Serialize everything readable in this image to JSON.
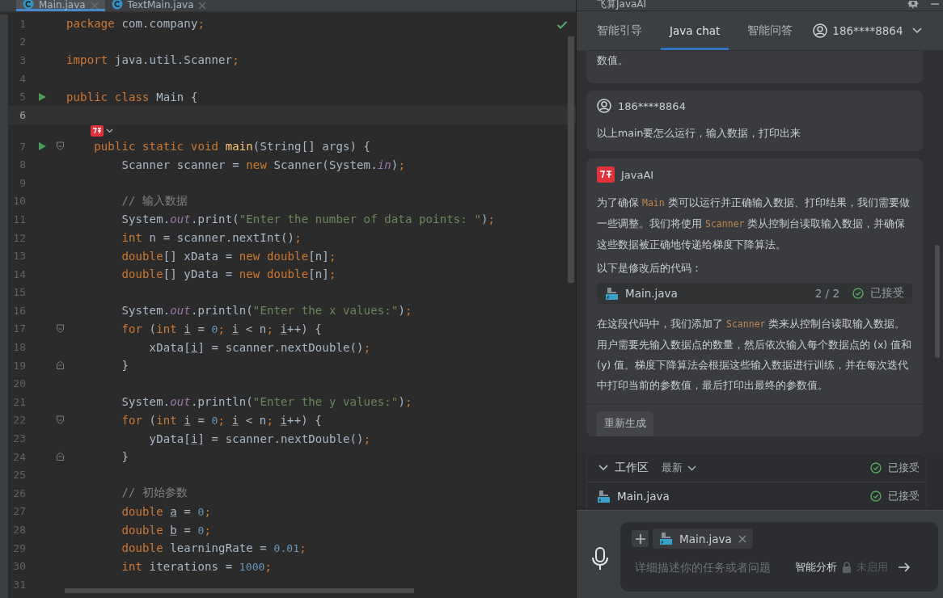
{
  "editor": {
    "tabs": [
      {
        "label": "Main.java",
        "selected": true
      },
      {
        "label": "TextMain.java",
        "selected": false
      }
    ],
    "lines": [
      {
        "number": "1",
        "tokens": [
          {
            "kind": "kw",
            "text": "package"
          },
          {
            "kind": "plain",
            "text": " com.company"
          },
          {
            "kind": "kw",
            "text": ";"
          }
        ]
      },
      {
        "number": "2"
      },
      {
        "number": "3",
        "tokens": [
          {
            "kind": "kw",
            "text": "import"
          },
          {
            "kind": "plain",
            "text": " java.util.Scanner"
          },
          {
            "kind": "kw",
            "text": ";"
          }
        ]
      },
      {
        "number": "4"
      },
      {
        "number": "5",
        "kind": "run",
        "tokens": [
          {
            "kind": "kw",
            "text": "public class"
          },
          {
            "kind": "plain",
            "text": " Main {"
          }
        ]
      },
      {
        "number": "6",
        "current": true
      },
      {
        "number": "7",
        "kind": "run-fold",
        "ai_hint": true,
        "tokens": [
          {
            "kind": "kw",
            "text": "    public static void "
          },
          {
            "kind": "method",
            "text": "main"
          },
          {
            "kind": "plain",
            "text": "(String[] args) {"
          }
        ]
      },
      {
        "number": "8",
        "tokens": [
          {
            "kind": "plain",
            "text": "        Scanner scanner = "
          },
          {
            "kind": "kw",
            "text": "new"
          },
          {
            "kind": "plain",
            "text": " Scanner(System."
          },
          {
            "kind": "field",
            "text": "in"
          },
          {
            "kind": "plain",
            "text": ")"
          },
          {
            "kind": "kw",
            "text": ";"
          }
        ]
      },
      {
        "number": "9"
      },
      {
        "number": "10",
        "tokens": [
          {
            "kind": "comment",
            "text": "        // 输入数据"
          }
        ]
      },
      {
        "number": "11",
        "tokens": [
          {
            "kind": "plain",
            "text": "        System."
          },
          {
            "kind": "field",
            "text": "out"
          },
          {
            "kind": "plain",
            "text": ".print("
          },
          {
            "kind": "str",
            "text": "\"Enter the number of data points: \""
          },
          {
            "kind": "plain",
            "text": ")"
          },
          {
            "kind": "kw",
            "text": ";"
          }
        ]
      },
      {
        "number": "12",
        "tokens": [
          {
            "kind": "kw",
            "text": "        int"
          },
          {
            "kind": "plain",
            "text": " n = scanner.nextInt()"
          },
          {
            "kind": "kw",
            "text": ";"
          }
        ]
      },
      {
        "number": "13",
        "tokens": [
          {
            "kind": "kw",
            "text": "        double"
          },
          {
            "kind": "plain",
            "text": "[] xData = "
          },
          {
            "kind": "kw",
            "text": "new double"
          },
          {
            "kind": "plain",
            "text": "[n]"
          },
          {
            "kind": "kw",
            "text": ";"
          }
        ]
      },
      {
        "number": "14",
        "tokens": [
          {
            "kind": "kw",
            "text": "        double"
          },
          {
            "kind": "plain",
            "text": "[] yData = "
          },
          {
            "kind": "kw",
            "text": "new double"
          },
          {
            "kind": "plain",
            "text": "[n]"
          },
          {
            "kind": "kw",
            "text": ";"
          }
        ]
      },
      {
        "number": "15"
      },
      {
        "number": "16",
        "tokens": [
          {
            "kind": "plain",
            "text": "        System."
          },
          {
            "kind": "field",
            "text": "out"
          },
          {
            "kind": "plain",
            "text": ".println("
          },
          {
            "kind": "str",
            "text": "\"Enter the x values:\""
          },
          {
            "kind": "plain",
            "text": ")"
          },
          {
            "kind": "kw",
            "text": ";"
          }
        ]
      },
      {
        "number": "17",
        "kind": "fold",
        "tokens": [
          {
            "kind": "kw",
            "text": "        for"
          },
          {
            "kind": "plain",
            "text": " ("
          },
          {
            "kind": "kw",
            "text": "int "
          },
          {
            "kind": "var",
            "text": "i"
          },
          {
            "kind": "plain",
            "text": " = "
          },
          {
            "kind": "num",
            "text": "0"
          },
          {
            "kind": "kw",
            "text": "; "
          },
          {
            "kind": "var",
            "text": "i"
          },
          {
            "kind": "plain",
            "text": " < n"
          },
          {
            "kind": "kw",
            "text": "; "
          },
          {
            "kind": "var",
            "text": "i"
          },
          {
            "kind": "plain",
            "text": "++) {"
          }
        ]
      },
      {
        "number": "18",
        "tokens": [
          {
            "kind": "plain",
            "text": "            xData["
          },
          {
            "kind": "var",
            "text": "i"
          },
          {
            "kind": "plain",
            "text": "] = scanner.nextDouble()"
          },
          {
            "kind": "kw",
            "text": ";"
          }
        ]
      },
      {
        "number": "19",
        "kind": "fold-end",
        "tokens": [
          {
            "kind": "plain",
            "text": "        }"
          }
        ]
      },
      {
        "number": "20"
      },
      {
        "number": "21",
        "tokens": [
          {
            "kind": "plain",
            "text": "        System."
          },
          {
            "kind": "field",
            "text": "out"
          },
          {
            "kind": "plain",
            "text": ".println("
          },
          {
            "kind": "str",
            "text": "\"Enter the y values:\""
          },
          {
            "kind": "plain",
            "text": ")"
          },
          {
            "kind": "kw",
            "text": ";"
          }
        ]
      },
      {
        "number": "22",
        "kind": "fold",
        "tokens": [
          {
            "kind": "kw",
            "text": "        for"
          },
          {
            "kind": "plain",
            "text": " ("
          },
          {
            "kind": "kw",
            "text": "int "
          },
          {
            "kind": "var",
            "text": "i"
          },
          {
            "kind": "plain",
            "text": " = "
          },
          {
            "kind": "num",
            "text": "0"
          },
          {
            "kind": "kw",
            "text": "; "
          },
          {
            "kind": "var",
            "text": "i"
          },
          {
            "kind": "plain",
            "text": " < n"
          },
          {
            "kind": "kw",
            "text": "; "
          },
          {
            "kind": "var",
            "text": "i"
          },
          {
            "kind": "plain",
            "text": "++) {"
          }
        ]
      },
      {
        "number": "23",
        "tokens": [
          {
            "kind": "plain",
            "text": "            yData["
          },
          {
            "kind": "var",
            "text": "i"
          },
          {
            "kind": "plain",
            "text": "] = scanner.nextDouble()"
          },
          {
            "kind": "kw",
            "text": ";"
          }
        ]
      },
      {
        "number": "24",
        "kind": "fold-end",
        "tokens": [
          {
            "kind": "plain",
            "text": "        }"
          }
        ]
      },
      {
        "number": "25"
      },
      {
        "number": "26",
        "tokens": [
          {
            "kind": "comment",
            "text": "        // 初始参数"
          }
        ]
      },
      {
        "number": "27",
        "tokens": [
          {
            "kind": "kw",
            "text": "        double "
          },
          {
            "kind": "var",
            "text": "a"
          },
          {
            "kind": "plain",
            "text": " = "
          },
          {
            "kind": "num",
            "text": "0"
          },
          {
            "kind": "kw",
            "text": ";"
          }
        ]
      },
      {
        "number": "28",
        "tokens": [
          {
            "kind": "kw",
            "text": "        double "
          },
          {
            "kind": "var",
            "text": "b"
          },
          {
            "kind": "plain",
            "text": " = "
          },
          {
            "kind": "num",
            "text": "0"
          },
          {
            "kind": "kw",
            "text": ";"
          }
        ]
      },
      {
        "number": "29",
        "tokens": [
          {
            "kind": "kw",
            "text": "        double"
          },
          {
            "kind": "plain",
            "text": " learningRate = "
          },
          {
            "kind": "num",
            "text": "0.01"
          },
          {
            "kind": "kw",
            "text": ";"
          }
        ]
      },
      {
        "number": "30",
        "tokens": [
          {
            "kind": "kw",
            "text": "        int"
          },
          {
            "kind": "plain",
            "text": " iterations = "
          },
          {
            "kind": "num",
            "text": "1000"
          },
          {
            "kind": "kw",
            "text": ";"
          }
        ]
      },
      {
        "number": "31"
      }
    ]
  },
  "panel": {
    "title": "飞算JavaAI",
    "tabs": [
      {
        "label": "智能引导",
        "selected": false
      },
      {
        "label": "Java chat",
        "selected": true
      },
      {
        "label": "智能问答",
        "selected": false
      }
    ],
    "user": "186****8864",
    "messages": [
      {
        "kind": "tail",
        "paragraphs": [
          [
            {
              "kind": "text",
              "text": "数值。"
            }
          ]
        ]
      },
      {
        "kind": "user",
        "author": "186****8864",
        "paragraphs": [
          [
            {
              "kind": "text",
              "text": "以上main要怎么运行，输入数据，打印出来"
            }
          ]
        ]
      },
      {
        "kind": "ai",
        "author": "JavaAI",
        "paragraphs": [
          [
            {
              "kind": "text",
              "text": "为了确保 "
            },
            {
              "kind": "code",
              "text": "Main"
            },
            {
              "kind": "text",
              "text": " 类可以运行并正确输入数据、打印结果，我们需要做一些调整。我们将使用 "
            },
            {
              "kind": "code",
              "text": "Scanner"
            },
            {
              "kind": "text",
              "text": " 类从控制台读取输入数据，并确保这些数据被正确地传递给梯度下降算法。"
            }
          ],
          [
            {
              "kind": "text",
              "text": "以下是修改后的代码："
            }
          ]
        ],
        "file": {
          "name": "Main.java",
          "count": "2 / 2",
          "status": "已接受"
        },
        "after": [
          [
            {
              "kind": "text",
              "text": "在这段代码中，我们添加了 "
            },
            {
              "kind": "code",
              "text": "Scanner"
            },
            {
              "kind": "text",
              "text": " 类来从控制台读取输入数据。用户需要先输入数据点的数量，然后依次输入每个数据点的 (x) 值和 (y) 值。梯度下降算法会根据这些输入数据进行训练，并在每次迭代中打印当前的参数值，最后打印出最终的参数值。"
            }
          ]
        ],
        "action": "重新生成"
      }
    ],
    "workspace": {
      "title": "工作区",
      "filter": "最新",
      "status": "已接受",
      "expanded": true,
      "files": [
        {
          "name": "Main.java",
          "status": "已接受"
        }
      ]
    },
    "input": {
      "attachment": "Main.java",
      "placeholder": "详细描述你的任务或者问题",
      "mode": "智能分析",
      "mode_state": "未启用"
    }
  }
}
